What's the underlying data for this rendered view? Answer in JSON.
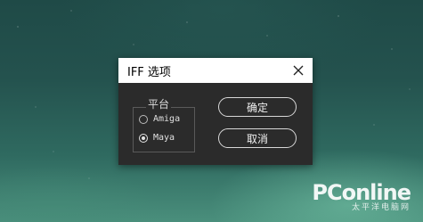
{
  "dialog": {
    "title": "IFF 选项",
    "close_icon": "close-icon",
    "group": {
      "label": "平台",
      "options": [
        {
          "label": "Amiga",
          "checked": false
        },
        {
          "label": "Maya",
          "checked": true
        }
      ]
    },
    "buttons": {
      "ok": "确定",
      "cancel": "取消"
    }
  },
  "watermark": {
    "logo": "PConline",
    "subtitle": "太平洋电脑网"
  }
}
